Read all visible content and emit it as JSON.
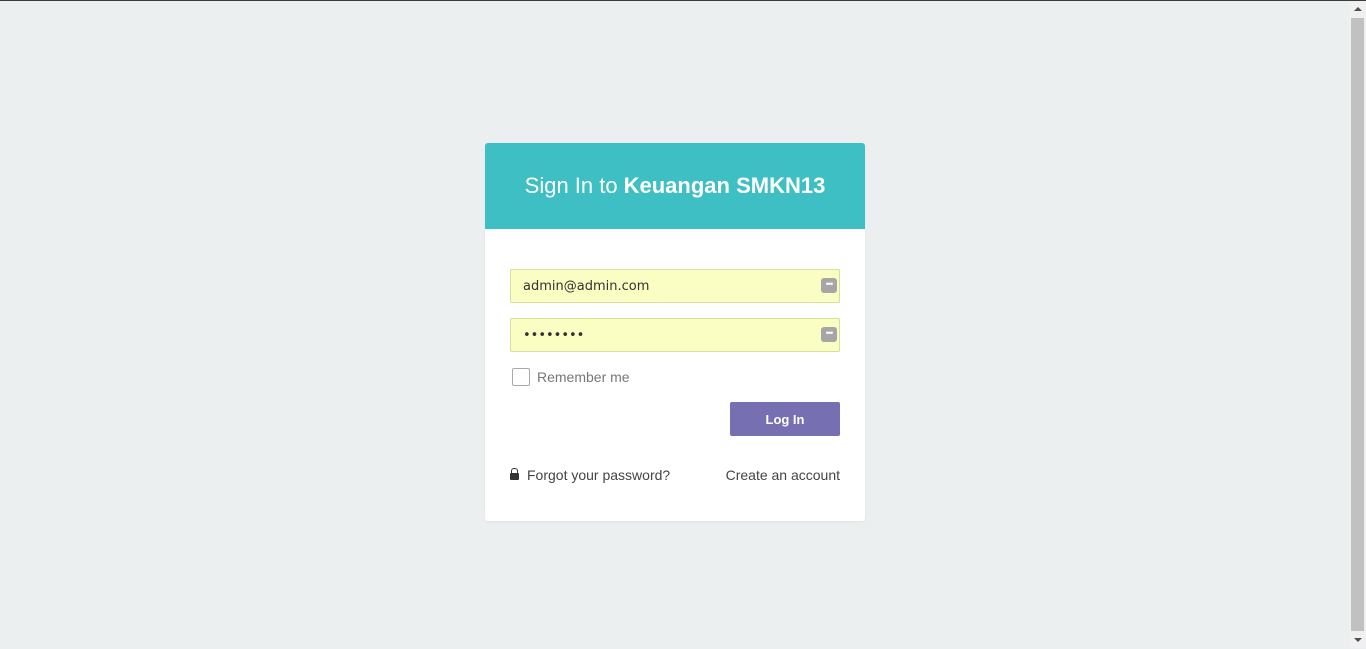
{
  "login": {
    "title_prefix": "Sign In to",
    "title_brand": "Keuangan SMKN13",
    "email_value": "admin@admin.com",
    "password_value": "••••••••",
    "remember_label": "Remember me",
    "login_button": "Log In",
    "forgot_label": "Forgot your password?",
    "create_label": "Create an account"
  },
  "icons": {
    "password_manager": "password-manager-icon",
    "lock": "lock-icon"
  },
  "colors": {
    "header": "#3dbfc4",
    "button": "#7670b3",
    "autofill": "#fafec2",
    "background": "#ebeff0"
  }
}
